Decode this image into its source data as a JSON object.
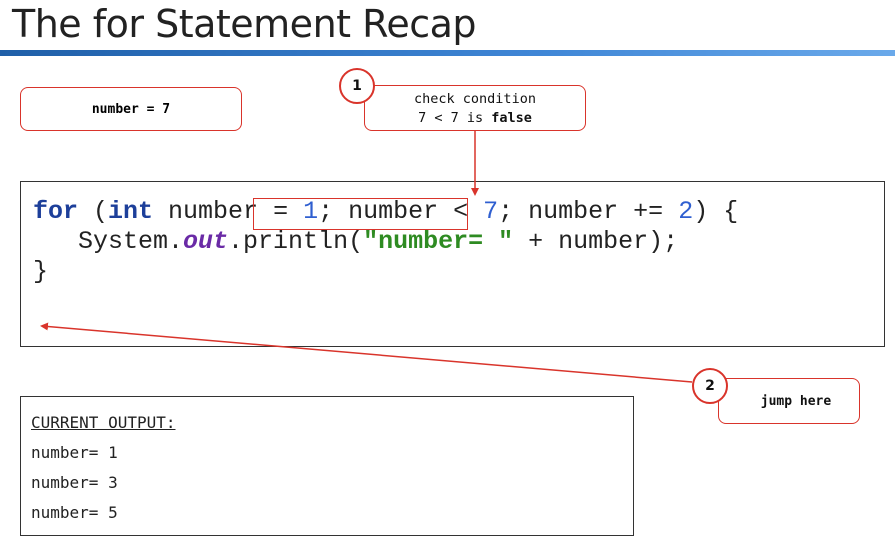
{
  "title": "The for Statement Recap",
  "variable_box": {
    "text": "number = 7"
  },
  "step1": {
    "number": "1",
    "line1": "check condition",
    "line2_prefix": "7 < 7 is ",
    "line2_bold": "false"
  },
  "step2": {
    "number": "2",
    "text": "jump here"
  },
  "code": {
    "line1": {
      "kw_for": "for",
      "open": " (",
      "kw_int": "int",
      "decl": " number = ",
      "init": "1",
      "sep1": "; ",
      "cond_var": "number < ",
      "cond_val": "7",
      "sep2": "; number += ",
      "step": "2",
      "close": ") {"
    },
    "line2": {
      "indent_obj": "   System.",
      "field": "out",
      "method": ".println(",
      "string": "\"number= \"",
      "rest": " + number);"
    },
    "line3": "}"
  },
  "output": {
    "header": "CURRENT OUTPUT:",
    "lines": [
      "number= 1",
      "number= 3",
      "number= 5"
    ]
  },
  "colors": {
    "accent_red": "#d9342b",
    "keyword": "#1d3f9a",
    "number_literal": "#2f5fd0",
    "string_literal": "#2e8b22",
    "field": "#6a2aa6"
  }
}
